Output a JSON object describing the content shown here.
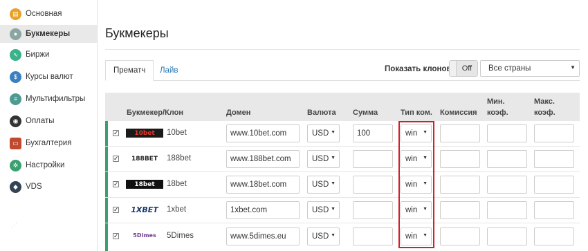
{
  "sidebar": {
    "items": [
      {
        "label": "Основная",
        "icon": "dashboard-icon",
        "color": "#e8a22a"
      },
      {
        "label": "Букмекеры",
        "icon": "soccer-ball-icon",
        "color": "#8aa6a0"
      },
      {
        "label": "Биржи",
        "icon": "exchange-icon",
        "color": "#3ab28a"
      },
      {
        "label": "Курсы валют",
        "icon": "currency-icon",
        "color": "#3a7fc0"
      },
      {
        "label": "Мультифильтры",
        "icon": "filter-icon",
        "color": "#4e9a90"
      },
      {
        "label": "Оплаты",
        "icon": "payment-icon",
        "color": "#333333"
      },
      {
        "label": "Бухгалтерия",
        "icon": "briefcase-icon",
        "color": "#c0492e"
      },
      {
        "label": "Настройки",
        "icon": "gear-icon",
        "color": "#3aa070"
      },
      {
        "label": "VDS",
        "icon": "diamond-icon",
        "color": "#334455"
      }
    ]
  },
  "page_title": "Букмекеры",
  "tabs": [
    {
      "label": "Прематч"
    },
    {
      "label": "Лайв"
    }
  ],
  "clones": {
    "label": "Показать клонов:",
    "toggle_value": "Off"
  },
  "country_filter": {
    "value": "Все страны"
  },
  "table": {
    "headers": {
      "bookmaker": "Букмекер/Клон",
      "domain": "Домен",
      "currency": "Валюта",
      "amount": "Сумма",
      "commission_type": "Тип ком.",
      "commission": "Комиссия",
      "min_coef": "Мин. коэф.",
      "max_coef": "Макс. коэф."
    },
    "rows": [
      {
        "logo": "10bet",
        "name": "10bet",
        "domain": "www.10bet.com",
        "currency": "USD",
        "amount": "100",
        "commission_type": "win",
        "commission": "",
        "min_coef": "",
        "max_coef": ""
      },
      {
        "logo": "188BET",
        "name": "188bet",
        "domain": "www.188bet.com",
        "currency": "USD",
        "amount": "",
        "commission_type": "win",
        "commission": "",
        "min_coef": "",
        "max_coef": ""
      },
      {
        "logo": "18bet",
        "name": "18bet",
        "domain": "www.18bet.com",
        "currency": "USD",
        "amount": "",
        "commission_type": "win",
        "commission": "",
        "min_coef": "",
        "max_coef": ""
      },
      {
        "logo": "1XBET",
        "name": "1xbet",
        "domain": "1xbet.com",
        "currency": "USD",
        "amount": "",
        "commission_type": "win",
        "commission": "",
        "min_coef": "",
        "max_coef": ""
      },
      {
        "logo": "5Dimes",
        "name": "5Dimes",
        "domain": "www.5dimes.eu",
        "currency": "USD",
        "amount": "",
        "commission_type": "win",
        "commission": "",
        "min_coef": "",
        "max_coef": ""
      }
    ]
  },
  "colors": {
    "accent": "#3d9f6d",
    "link": "#2a7ab8",
    "highlight": "#d0202a"
  }
}
